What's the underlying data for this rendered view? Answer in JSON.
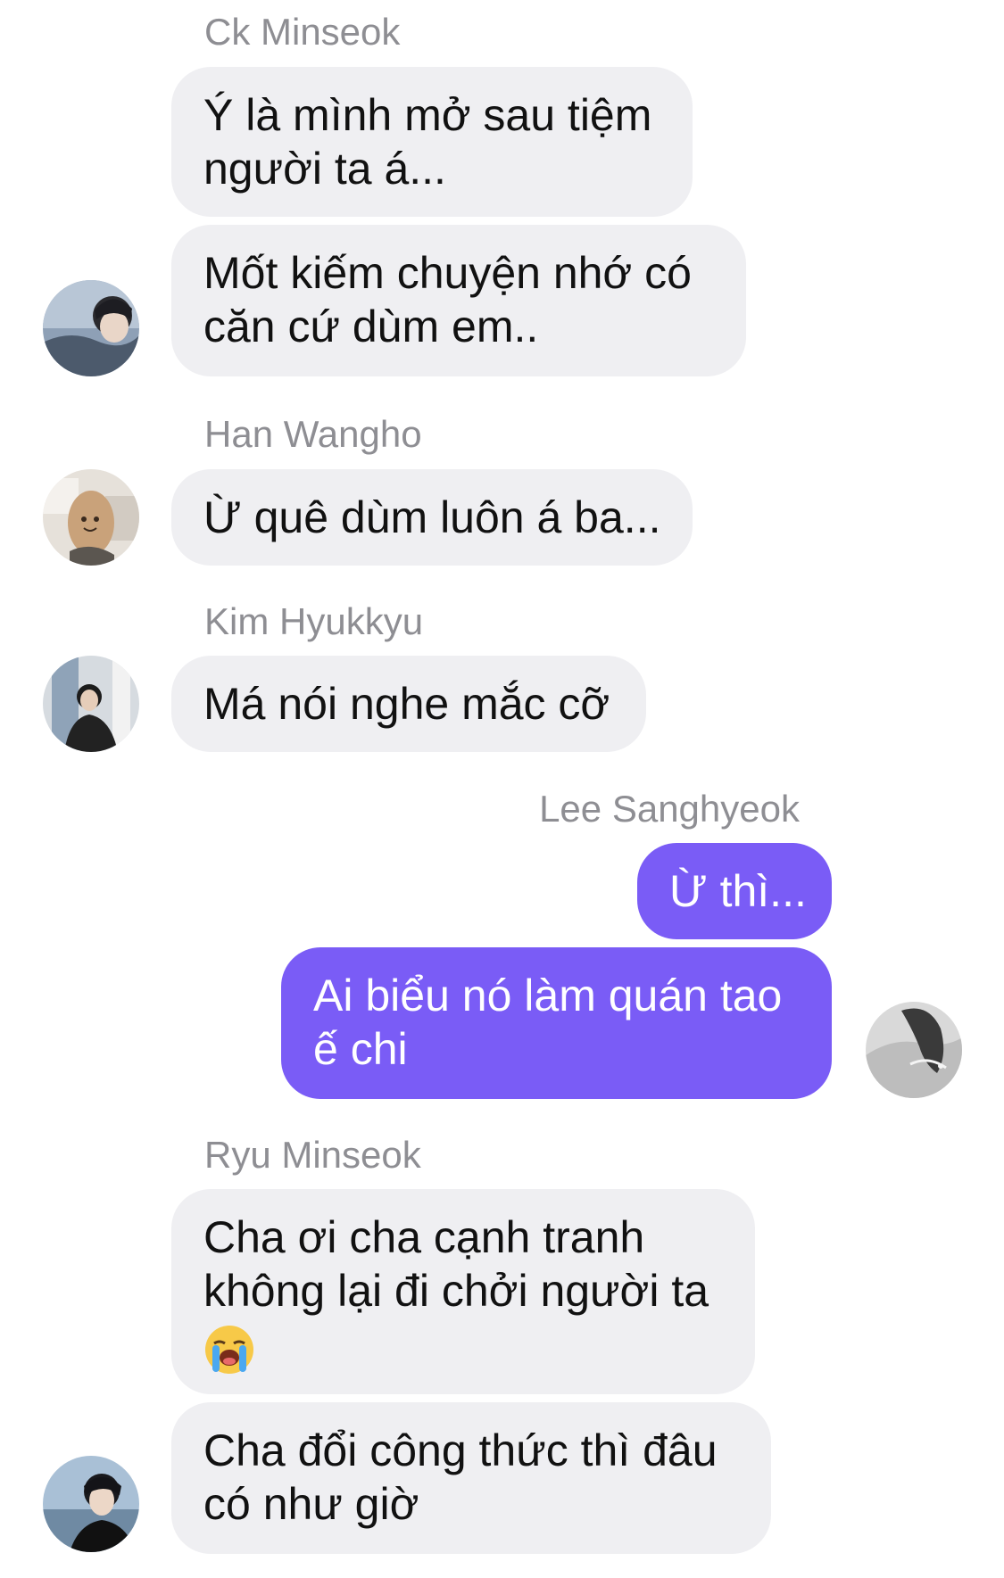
{
  "chat": {
    "groups": [
      {
        "sender": "Ck Minseok",
        "messages": [
          [
            "Ý là mình mở sau tiệm",
            "người ta á..."
          ],
          [
            "Mốt kiếm chuyện nhớ có",
            "căn cứ dùm em.."
          ]
        ]
      },
      {
        "sender": "Han Wangho",
        "messages": [
          [
            "Ừ quê dùm luôn á ba..."
          ]
        ]
      },
      {
        "sender": "Kim Hyukkyu",
        "messages": [
          [
            "Má nói nghe mắc cỡ"
          ]
        ]
      },
      {
        "sender": "Lee Sanghyeok",
        "messages": [
          [
            "Ừ thì..."
          ],
          [
            "Ai biểu nó làm quán tao",
            "ế chi"
          ]
        ]
      },
      {
        "sender": "Ryu Minseok",
        "messages": [
          [
            "Cha ơi cha cạnh tranh",
            "không lại đi chởi người ta"
          ],
          [
            "Cha đổi công thức thì đâu",
            "có như giờ"
          ]
        ]
      }
    ],
    "emoji": "loudly-crying-face-emoji",
    "colors": {
      "incoming_bubble": "#efeff2",
      "outgoing_bubble": "#7a5cf6",
      "sender_name": "#8e8e93"
    }
  }
}
